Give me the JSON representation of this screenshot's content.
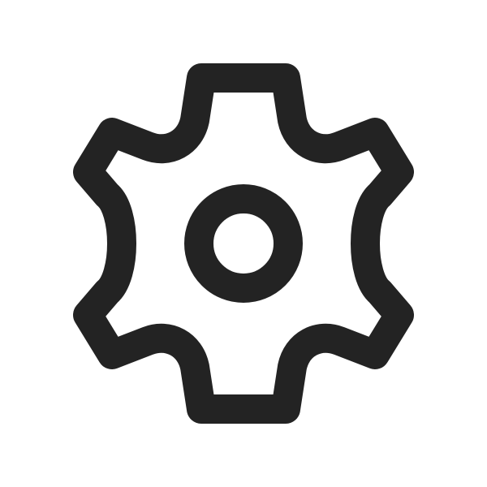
{
  "icon": {
    "name": "gear-icon",
    "meaning": "settings",
    "color": "#232323"
  },
  "background": "#ffffff"
}
